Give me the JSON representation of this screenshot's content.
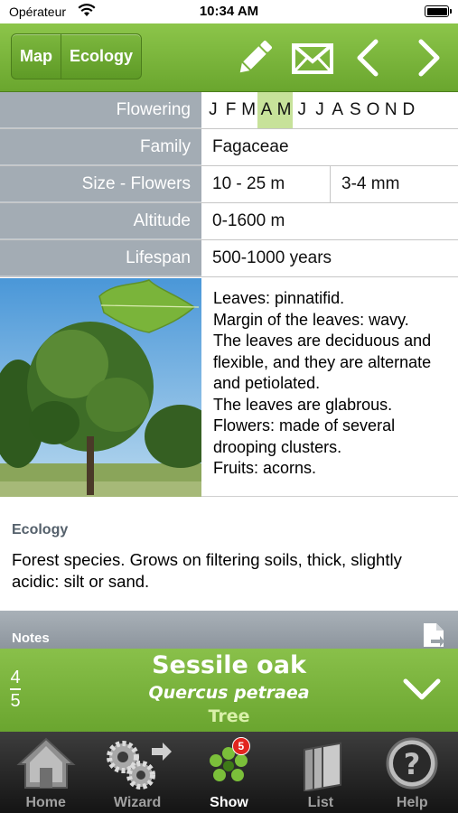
{
  "status_bar": {
    "carrier": "Opérateur",
    "time": "10:34 AM"
  },
  "toolbar": {
    "segments": [
      "Map",
      "Ecology"
    ],
    "icons": [
      "pencil-icon",
      "envelope-icon",
      "chevron-left-icon",
      "chevron-right-icon"
    ]
  },
  "info": {
    "flowering": {
      "label": "Flowering",
      "months": [
        "J",
        "F",
        "M",
        "A",
        "M",
        "J",
        "J",
        "A",
        "S",
        "O",
        "N",
        "D"
      ],
      "active": [
        3,
        4
      ]
    },
    "family": {
      "label": "Family",
      "value": "Fagaceae"
    },
    "size": {
      "label": "Size - Flowers",
      "size_value": "10 - 25 m",
      "flowers_value": "3-4 mm"
    },
    "altitude": {
      "label": "Altitude",
      "value": "0-1600 m"
    },
    "lifespan": {
      "label": "Lifespan",
      "value": "500-1000 years"
    }
  },
  "description": "Leaves: pinnatifid.\nMargin of the leaves: wavy.\nThe leaves are deciduous and flexible, and they are alternate and petiolated.\nThe leaves are glabrous.\nFlowers: made of several drooping clusters.\nFruits: acorns.",
  "ecology": {
    "title": "Ecology",
    "text": "Forest species. Grows on  filtering soils, thick, slightly acidic: silt or sand."
  },
  "notes": {
    "title": "Notes"
  },
  "species": {
    "index": "4",
    "total": "5",
    "name": "Sessile oak",
    "latin": "Quercus petraea",
    "type": "Tree"
  },
  "tabs": [
    {
      "label": "Home",
      "icon": "house-icon",
      "active": false
    },
    {
      "label": "Wizard",
      "icon": "gears-icon",
      "active": false
    },
    {
      "label": "Show",
      "icon": "flower-icon",
      "active": true,
      "badge": "5"
    },
    {
      "label": "List",
      "icon": "books-icon",
      "active": false
    },
    {
      "label": "Help",
      "icon": "question-icon",
      "active": false
    }
  ],
  "colors": {
    "accent_green": "#7ab73b",
    "label_gray": "#a3acb4",
    "month_highlight": "#c7e29a",
    "badge_red": "#e2251f"
  }
}
